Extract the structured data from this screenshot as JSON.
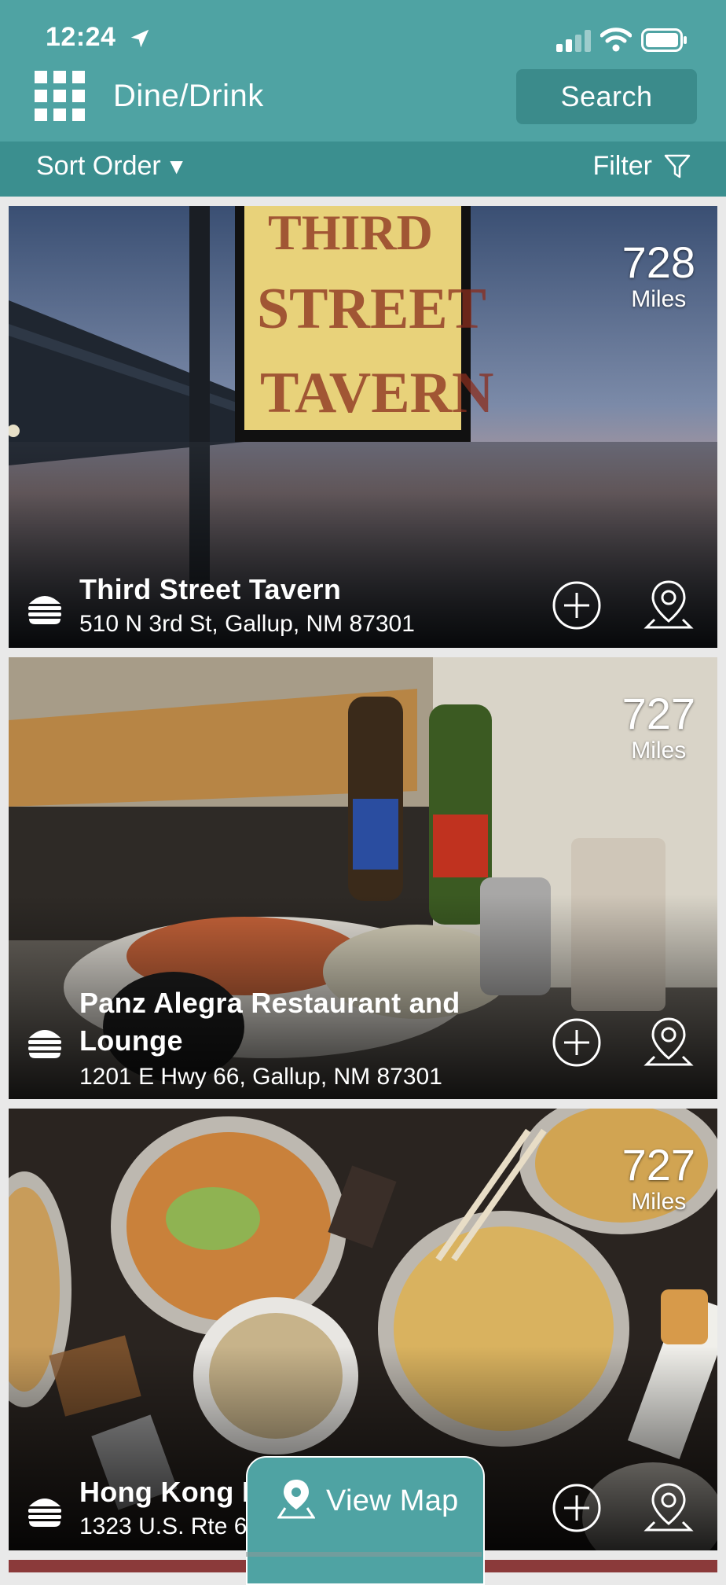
{
  "status_bar": {
    "time": "12:24",
    "icons": [
      "location-arrow-icon",
      "signal-icon",
      "wifi-icon",
      "battery-icon"
    ]
  },
  "header": {
    "menu_icon": "grid-icon",
    "title": "Dine/Drink",
    "search_label": "Search"
  },
  "subbar": {
    "sort_label": "Sort Order",
    "sort_caret": "▼",
    "filter_label": "Filter"
  },
  "listings": [
    {
      "name": "Third Street Tavern",
      "address": "510 N 3rd St, Gallup, NM 87301",
      "distance": "728",
      "distance_unit": "Miles",
      "category_icon": "burger-icon"
    },
    {
      "name": "Panz Alegra Restaurant and Lounge",
      "address": "1201 E Hwy 66, Gallup, NM 87301",
      "distance": "727",
      "distance_unit": "Miles",
      "category_icon": "burger-icon"
    },
    {
      "name": "Hong Kong R",
      "address": "1323 U.S. Rte 6",
      "distance": "727",
      "distance_unit": "Miles",
      "category_icon": "burger-icon"
    }
  ],
  "view_map": {
    "label": "View Map"
  },
  "colors": {
    "header": "#4fa3a3",
    "subbar": "#3b8f8f",
    "button": "#3b8b8b",
    "text": "#ffffff"
  }
}
